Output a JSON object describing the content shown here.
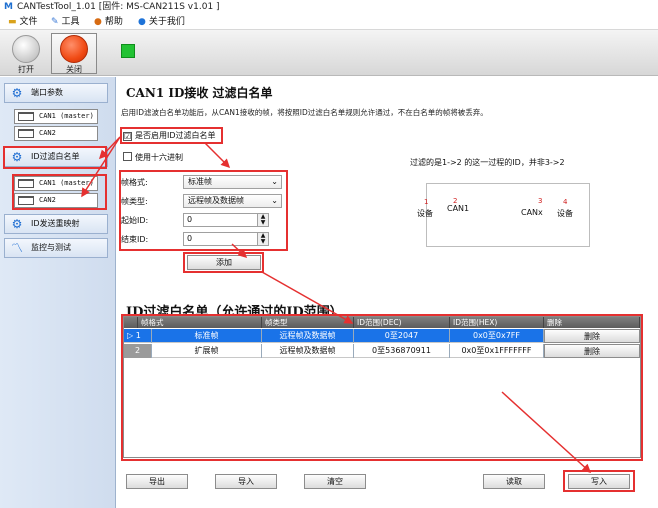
{
  "window": {
    "logo": "M",
    "title": "CANTestTool_1.01  [固件:  MS-CAN211S v1.01 ]"
  },
  "menu": [
    {
      "icon": "folder-icon",
      "label": "文件"
    },
    {
      "icon": "tools-icon",
      "label": "工具"
    },
    {
      "icon": "help-icon",
      "label": "帮助"
    },
    {
      "icon": "about-icon",
      "label": "关于我们"
    }
  ],
  "toolbar": {
    "open_label": "打开",
    "close_label": "关闭",
    "status_color": "#22c233"
  },
  "sidebar": {
    "port_params": "端口参数",
    "can1_master": "CAN1 (master)",
    "can2": "CAN2",
    "id_whitelist": "ID过滤白名单",
    "can1_master_2": "CAN1 (master)",
    "can2_2": "CAN2",
    "id_remap": "ID发送重映射",
    "monitor": "监控与测试"
  },
  "main": {
    "title": "CAN1  ID接收  过滤白名单",
    "description": "启用ID滤波白名单功能后，从CAN1接收的帧，将按照ID过滤白名单规则允许通过，不在白名单的帧将被丢弃。",
    "enable_filter_label": "是否启用ID过滤白名单",
    "enable_filter_checked": "☑",
    "hex_label": "使用十六进制",
    "frame_format_label": "帧格式:",
    "frame_format_value": "标准帧",
    "frame_type_label": "帧类型:",
    "frame_type_value": "远程帧及数据帧",
    "start_id_label": "起始ID:",
    "start_id_value": "0",
    "end_id_label": "结束ID:",
    "end_id_value": "0",
    "add_button": "添加"
  },
  "diagram": {
    "caption": "过滤的是1->2 的这一过程的ID，并非3->2",
    "n1": "1",
    "device_left": "设备",
    "n2": "2",
    "can1": "CAN1",
    "n3": "3",
    "canx": "CANx",
    "n4": "4",
    "device_right": "设备"
  },
  "table": {
    "title": "ID过滤白名单（允许通过的ID范围）",
    "columns": [
      "",
      "帧格式",
      "帧类型",
      "ID范围(DEC)",
      "ID范围(HEX)",
      "删除"
    ],
    "rows": [
      {
        "index": "1",
        "marker": "▷",
        "format": "标准帧",
        "type": "远程帧及数据帧",
        "dec": "0至2047",
        "hex": "0x0至0x7FF",
        "delete": "删除"
      },
      {
        "index": "2",
        "marker": "",
        "format": "扩展帧",
        "type": "远程帧及数据帧",
        "dec": "0至536870911",
        "hex": "0x0至0x1FFFFFFF",
        "delete": "删除"
      }
    ]
  },
  "bottom": {
    "export": "导出",
    "import": "导入",
    "clear": "清空",
    "read": "读取",
    "write": "写入"
  },
  "colors": {
    "annotation": "#e53030",
    "selected_row": "#1a73e8",
    "row_index_bg": "#9a9a9a"
  }
}
